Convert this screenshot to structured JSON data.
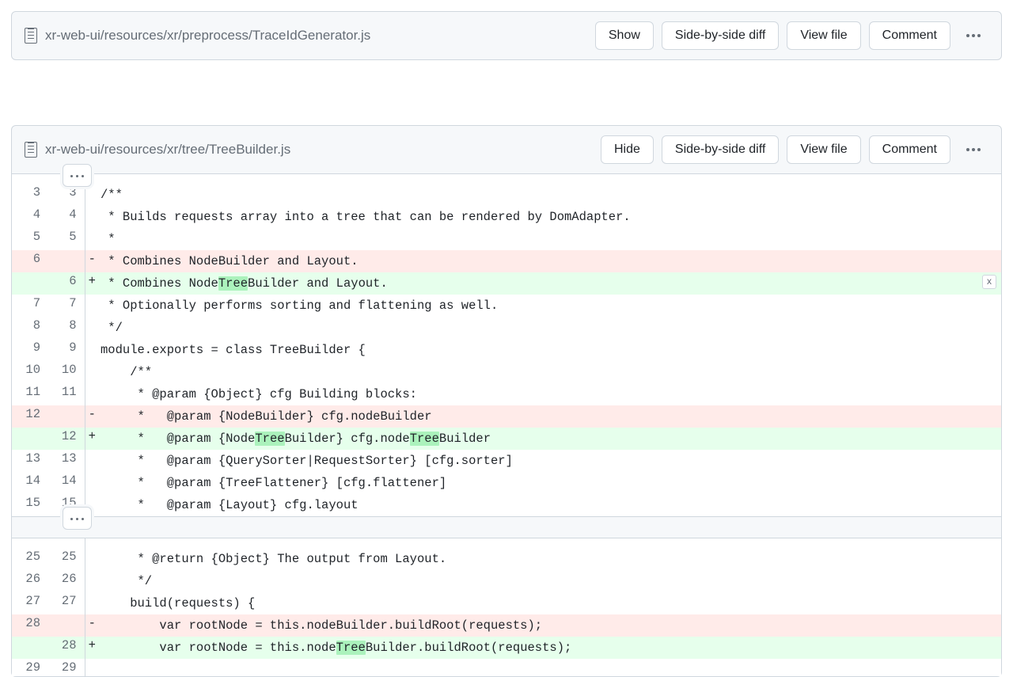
{
  "files": [
    {
      "path": "xr-web-ui/resources/xr/preprocess/TraceIdGenerator.js",
      "toggle": "Show",
      "btns": {
        "sbs": "Side-by-side diff",
        "view": "View file",
        "comment": "Comment"
      }
    },
    {
      "path": "xr-web-ui/resources/xr/tree/TreeBuilder.js",
      "toggle": "Hide",
      "btns": {
        "sbs": "Side-by-side diff",
        "view": "View file",
        "comment": "Comment"
      }
    }
  ],
  "close_x": "x",
  "hunks": [
    [
      {
        "t": "ctx",
        "o": "3",
        "n": "3",
        "m": " ",
        "c": "/**"
      },
      {
        "t": "ctx",
        "o": "4",
        "n": "4",
        "m": " ",
        "c": " * Builds requests array into a tree that can be rendered by DomAdapter."
      },
      {
        "t": "ctx",
        "o": "5",
        "n": "5",
        "m": " ",
        "c": " *"
      },
      {
        "t": "del",
        "o": "6",
        "n": "",
        "m": "-",
        "c": " * Combines NodeBuilder and Layout."
      },
      {
        "t": "add",
        "o": "",
        "n": "6",
        "m": "+",
        "seg": [
          " * Combines Node",
          [
            "hl",
            "Tree"
          ],
          "Builder and Layout."
        ],
        "close": true
      },
      {
        "t": "ctx",
        "o": "7",
        "n": "7",
        "m": " ",
        "c": " * Optionally performs sorting and flattening as well."
      },
      {
        "t": "ctx",
        "o": "8",
        "n": "8",
        "m": " ",
        "c": " */"
      },
      {
        "t": "ctx",
        "o": "9",
        "n": "9",
        "m": " ",
        "c": "module.exports = class TreeBuilder {"
      },
      {
        "t": "ctx",
        "o": "10",
        "n": "10",
        "m": " ",
        "c": "    /**"
      },
      {
        "t": "ctx",
        "o": "11",
        "n": "11",
        "m": " ",
        "c": "     * @param {Object} cfg Building blocks:"
      },
      {
        "t": "del",
        "o": "12",
        "n": "",
        "m": "-",
        "c": "     *   @param {NodeBuilder} cfg.nodeBuilder"
      },
      {
        "t": "add",
        "o": "",
        "n": "12",
        "m": "+",
        "seg": [
          "     *   @param {Node",
          [
            "hl",
            "Tree"
          ],
          "Builder} cfg.node",
          [
            "hl",
            "Tree"
          ],
          "Builder"
        ]
      },
      {
        "t": "ctx",
        "o": "13",
        "n": "13",
        "m": " ",
        "c": "     *   @param {QuerySorter|RequestSorter} [cfg.sorter]"
      },
      {
        "t": "ctx",
        "o": "14",
        "n": "14",
        "m": " ",
        "c": "     *   @param {TreeFlattener} [cfg.flattener]"
      },
      {
        "t": "ctx",
        "o": "15",
        "n": "15",
        "m": " ",
        "c": "     *   @param {Layout} cfg.layout"
      }
    ],
    [
      {
        "t": "ctx",
        "o": "25",
        "n": "25",
        "m": " ",
        "c": "     * @return {Object} The output from Layout."
      },
      {
        "t": "ctx",
        "o": "26",
        "n": "26",
        "m": " ",
        "c": "     */"
      },
      {
        "t": "ctx",
        "o": "27",
        "n": "27",
        "m": " ",
        "c": "    build(requests) {"
      },
      {
        "t": "del",
        "o": "28",
        "n": "",
        "m": "-",
        "c": "        var rootNode = this.nodeBuilder.buildRoot(requests);"
      },
      {
        "t": "add",
        "o": "",
        "n": "28",
        "m": "+",
        "seg": [
          "        var rootNode = this.node",
          [
            "hl",
            "Tree"
          ],
          "Builder.buildRoot(requests);"
        ]
      },
      {
        "t": "ctx",
        "o": "29",
        "n": "29",
        "m": " ",
        "c": ""
      }
    ]
  ]
}
